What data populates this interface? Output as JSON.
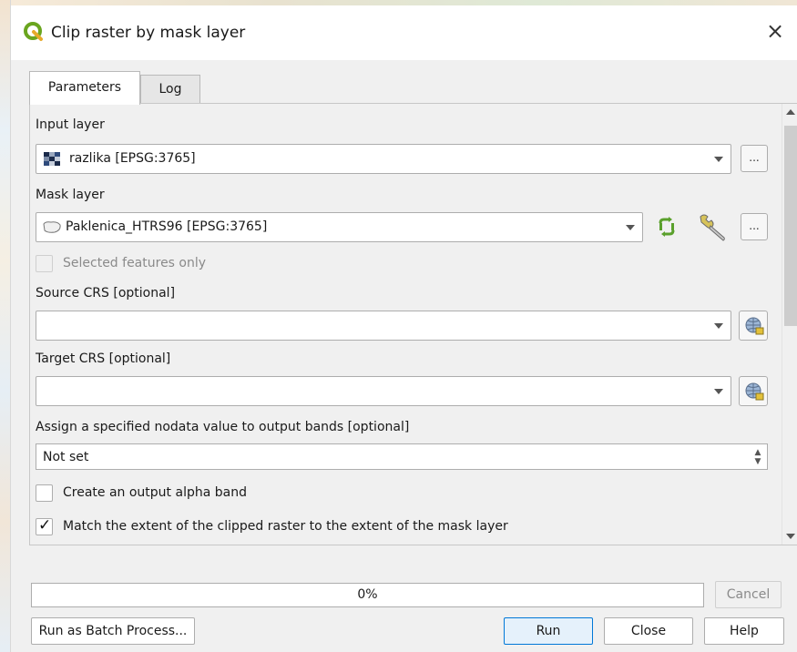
{
  "window": {
    "title": "Clip raster by mask layer",
    "close_glyph": "×"
  },
  "tabs": [
    {
      "label": "Parameters",
      "active": true
    },
    {
      "label": "Log",
      "active": false
    }
  ],
  "form": {
    "input_layer": {
      "label": "Input layer",
      "value": "razlika [EPSG:3765]",
      "icon": "raster-layer-icon",
      "browse_label": "..."
    },
    "mask_layer": {
      "label": "Mask layer",
      "value": "Paklenica_HTRS96 [EPSG:3765]",
      "icon": "polygon-layer-icon",
      "browse_label": "..."
    },
    "selected_features_only": {
      "label": "Selected features only",
      "checked": false,
      "enabled": false
    },
    "source_crs": {
      "label": "Source CRS [optional]",
      "value": ""
    },
    "target_crs": {
      "label": "Target CRS [optional]",
      "value": ""
    },
    "nodata": {
      "label": "Assign a specified nodata value to output bands [optional]",
      "value": "Not set"
    },
    "alpha_band": {
      "label": "Create an output alpha band",
      "checked": false
    },
    "match_extent": {
      "label": "Match the extent of the clipped raster to the extent of the mask layer",
      "checked": true
    }
  },
  "progress": {
    "label": "0%",
    "value": 0
  },
  "buttons": {
    "cancel": "Cancel",
    "batch": "Run as Batch Process...",
    "run": "Run",
    "close": "Close",
    "help": "Help"
  },
  "colors": {
    "qgis_green": "#8dc73f",
    "accent_blue": "#0078d7"
  }
}
